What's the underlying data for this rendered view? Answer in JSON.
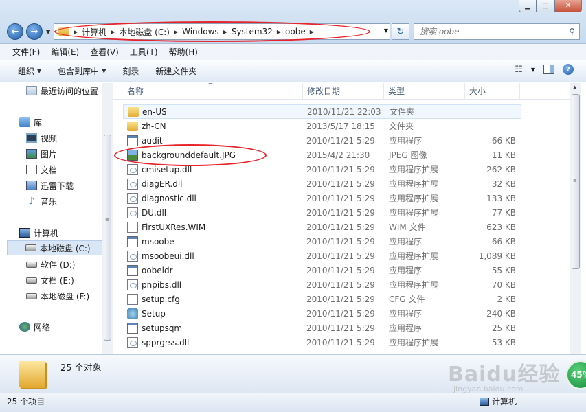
{
  "address": {
    "crumbs": [
      "计算机",
      "本地磁盘 (C:)",
      "Windows",
      "System32",
      "oobe"
    ]
  },
  "search": {
    "placeholder": "搜索 oobe"
  },
  "menu": [
    "文件(F)",
    "编辑(E)",
    "查看(V)",
    "工具(T)",
    "帮助(H)"
  ],
  "commands": {
    "organize": "组织",
    "include_in_library": "包含到库中",
    "burn": "刻录",
    "new_folder": "新建文件夹"
  },
  "nav": {
    "recent": "最近访问的位置",
    "libraries": "库",
    "videos": "视频",
    "pictures": "图片",
    "documents": "文档",
    "xunlei": "迅雷下载",
    "music": "音乐",
    "computer": "计算机",
    "drive_c": "本地磁盘 (C:)",
    "drive_d": "软件 (D:)",
    "drive_e": "文档 (E:)",
    "drive_f": "本地磁盘 (F:)",
    "network": "网络"
  },
  "columns": {
    "name": "名称",
    "date": "修改日期",
    "type": "类型",
    "size": "大小"
  },
  "files": [
    {
      "name": "en-US",
      "date": "2010/11/21 22:03",
      "type": "文件夹",
      "size": "",
      "icon": "folder-icon"
    },
    {
      "name": "zh-CN",
      "date": "2013/5/17 18:15",
      "type": "文件夹",
      "size": "",
      "icon": "folder-icon"
    },
    {
      "name": "audit",
      "date": "2010/11/21 5:29",
      "type": "应用程序",
      "size": "66 KB",
      "icon": "exe-icon"
    },
    {
      "name": "backgrounddefault.JPG",
      "date": "2015/4/2 21:30",
      "type": "JPEG 图像",
      "size": "11 KB",
      "icon": "jpg-icon"
    },
    {
      "name": "cmisetup.dll",
      "date": "2010/11/21 5:29",
      "type": "应用程序扩展",
      "size": "262 KB",
      "icon": "dll-icon"
    },
    {
      "name": "diagER.dll",
      "date": "2010/11/21 5:29",
      "type": "应用程序扩展",
      "size": "32 KB",
      "icon": "dll-icon"
    },
    {
      "name": "diagnostic.dll",
      "date": "2010/11/21 5:29",
      "type": "应用程序扩展",
      "size": "133 KB",
      "icon": "dll-icon"
    },
    {
      "name": "DU.dll",
      "date": "2010/11/21 5:29",
      "type": "应用程序扩展",
      "size": "77 KB",
      "icon": "dll-icon"
    },
    {
      "name": "FirstUXRes.WIM",
      "date": "2010/11/21 5:29",
      "type": "WIM 文件",
      "size": "623 KB",
      "icon": "file-icon"
    },
    {
      "name": "msoobe",
      "date": "2010/11/21 5:29",
      "type": "应用程序",
      "size": "66 KB",
      "icon": "exe-icon"
    },
    {
      "name": "msoobeui.dll",
      "date": "2010/11/21 5:29",
      "type": "应用程序扩展",
      "size": "1,089 KB",
      "icon": "dll-icon"
    },
    {
      "name": "oobeldr",
      "date": "2010/11/21 5:29",
      "type": "应用程序",
      "size": "55 KB",
      "icon": "exe-icon"
    },
    {
      "name": "pnpibs.dll",
      "date": "2010/11/21 5:29",
      "type": "应用程序扩展",
      "size": "70 KB",
      "icon": "dll-icon"
    },
    {
      "name": "setup.cfg",
      "date": "2010/11/21 5:29",
      "type": "CFG 文件",
      "size": "2 KB",
      "icon": "file-icon"
    },
    {
      "name": "Setup",
      "date": "2010/11/21 5:29",
      "type": "应用程序",
      "size": "240 KB",
      "icon": "setup-icon"
    },
    {
      "name": "setupsqm",
      "date": "2010/11/21 5:29",
      "type": "应用程序",
      "size": "25 KB",
      "icon": "exe-icon"
    },
    {
      "name": "spprgrss.dll",
      "date": "2010/11/21 5:29",
      "type": "应用程序扩展",
      "size": "53 KB",
      "icon": "dll-icon"
    }
  ],
  "details": {
    "count": "25 个对象"
  },
  "status": {
    "items": "25 个项目",
    "location": "计算机"
  },
  "watermark": {
    "main": "Baidu经验",
    "sub": "jingyan.baidu.com"
  },
  "gauge": {
    "value": "45%"
  },
  "annotation_color": "#e8232a"
}
